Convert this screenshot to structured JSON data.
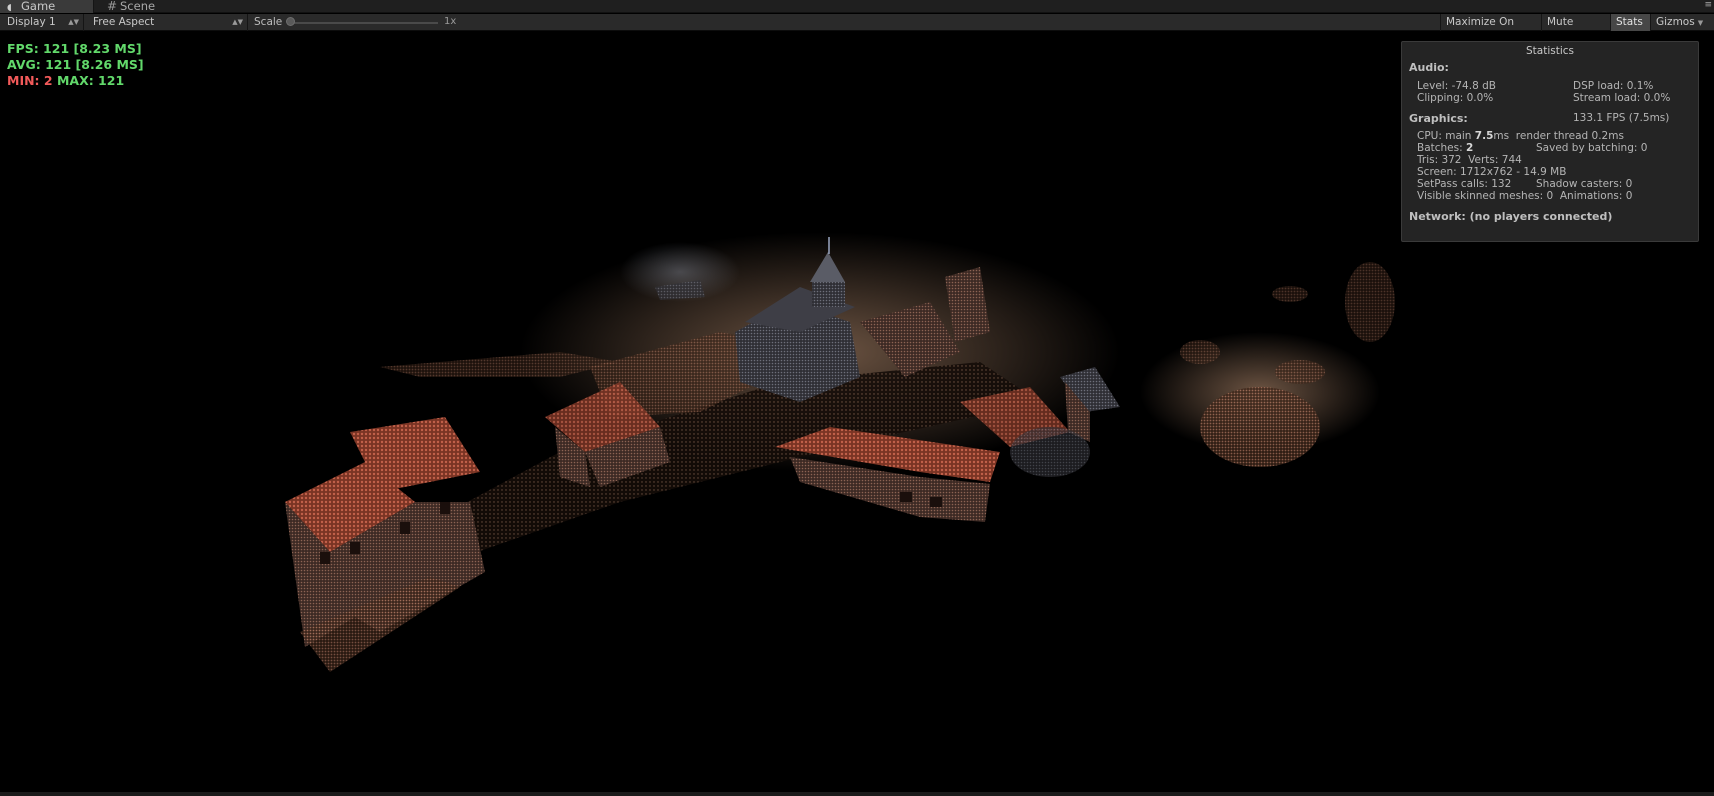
{
  "tabs": [
    {
      "label": "Game",
      "icon": "game-controller-icon"
    },
    {
      "label": "Scene",
      "icon": "grid-icon"
    }
  ],
  "tab_menu_glyph": "≡",
  "toolbar": {
    "display": "Display 1",
    "aspect": "Free Aspect",
    "scale_label": "Scale",
    "scale_value": "1x",
    "maximize": "Maximize On Play",
    "mute": "Mute Audio",
    "stats": "Stats",
    "gizmos": "Gizmos"
  },
  "fps_overlay": {
    "fps": "FPS: 121 [8.23 MS]",
    "avg": "AVG: 121 [8.26 MS]",
    "min_label": "MIN: 2",
    "max_label": " MAX: 121"
  },
  "statistics": {
    "title": "Statistics",
    "audio_heading": "Audio:",
    "level": "Level: -74.8 dB",
    "dsp_load": "DSP load: 0.1%",
    "clipping": "Clipping: 0.0%",
    "stream_load": "Stream load: 0.0%",
    "graphics_heading": "Graphics:",
    "graphics_fps": "133.1 FPS (7.5ms)",
    "cpu_prefix": "CPU: main ",
    "cpu_main": "7.5",
    "cpu_suffix": "ms  render thread 0.2ms",
    "batches_prefix": "Batches: ",
    "batches": "2",
    "saved_batching": "Saved by batching: 0",
    "tris_verts": "Tris: 372  Verts: 744",
    "screen": "Screen: 1712x762 - 14.9 MB",
    "setpass": "SetPass calls: 132",
    "shadow_casters": "Shadow casters: 0",
    "skinned_meshes": "Visible skinned meshes: 0  Animations: 0",
    "network": "Network: (no players connected)"
  },
  "colors": {
    "fps_green": "#62d96b",
    "fps_red": "#f25a5a",
    "panel_bg": "#242424",
    "stats_active": "#474747"
  }
}
